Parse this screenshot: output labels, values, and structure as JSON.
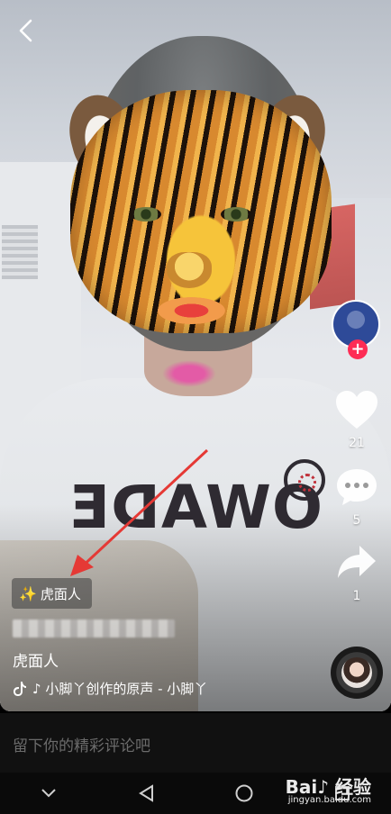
{
  "video": {
    "effect_chip_label": "虎面人",
    "caption": "虎面人",
    "music": "♪ 小脚丫创作的原声 - 小脚丫",
    "shirt_print": "OWADE"
  },
  "rail": {
    "likes": "21",
    "comments": "5",
    "shares": "1"
  },
  "comment_bar": {
    "placeholder": "留下你的精彩评论吧"
  },
  "watermark": {
    "brand": "Bai♪ 经验",
    "url": "jingyan.baidu.com"
  },
  "colors": {
    "accent": "#fe2c55",
    "arrow": "#e53935"
  }
}
